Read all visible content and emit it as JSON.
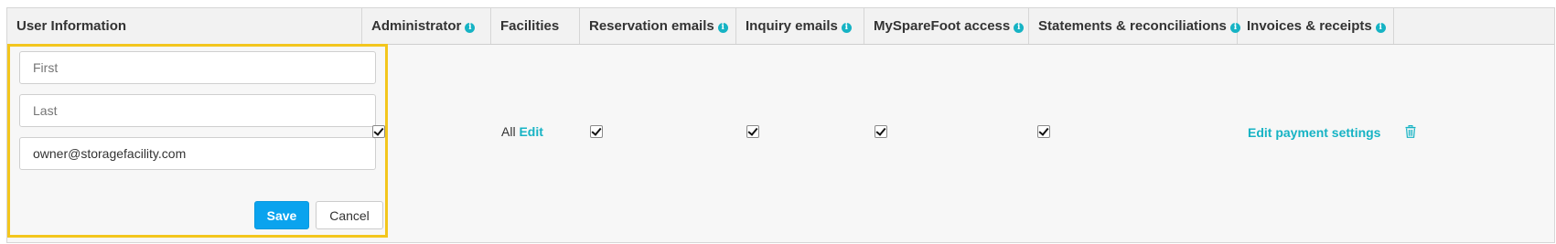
{
  "table": {
    "headers": [
      {
        "label": "User Information",
        "info": false
      },
      {
        "label": "Administrator",
        "info": true
      },
      {
        "label": "Facilities",
        "info": false
      },
      {
        "label": "Reservation emails",
        "info": true
      },
      {
        "label": "Inquiry emails",
        "info": true
      },
      {
        "label": "MySpareFoot access",
        "info": true
      },
      {
        "label": "Statements & reconciliations",
        "info": true
      },
      {
        "label": "Invoices & receipts",
        "info": true
      },
      {
        "label": "",
        "info": false
      }
    ],
    "info_glyph": "i"
  },
  "row": {
    "first_name": {
      "value": "",
      "placeholder": "First"
    },
    "last_name": {
      "value": "",
      "placeholder": "Last"
    },
    "email": {
      "value": "owner@storagefacility.com",
      "placeholder": ""
    },
    "save_label": "Save",
    "cancel_label": "Cancel",
    "administrator": true,
    "facilities_text": "All",
    "facilities_edit_label": "Edit",
    "reservation_emails": true,
    "inquiry_emails": true,
    "myspare_access": true,
    "statements": true,
    "edit_payment_label": "Edit payment settings"
  },
  "colors": {
    "accent": "#16b3c4",
    "primary_button": "#0aa3ee",
    "highlight_border": "#f3c61d"
  },
  "icons": [
    "info-icon",
    "checkbox-checked-icon",
    "trash-icon"
  ]
}
